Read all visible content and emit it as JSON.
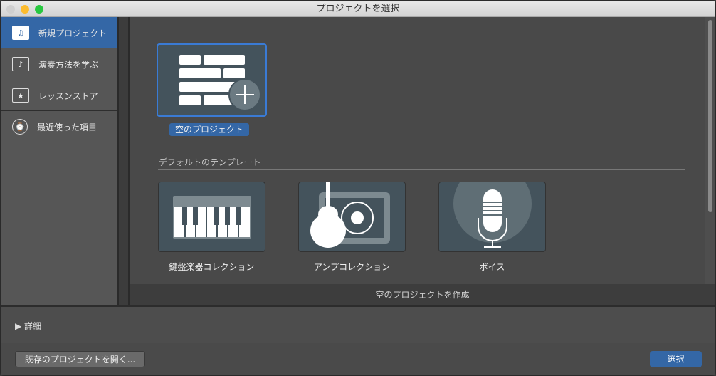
{
  "window": {
    "title": "プロジェクトを選択"
  },
  "sidebar": {
    "items": [
      {
        "label": "新規プロジェクト",
        "icon": "guitar-doc-icon"
      },
      {
        "label": "演奏方法を学ぶ",
        "icon": "note-icon"
      },
      {
        "label": "レッスンストア",
        "icon": "star-icon"
      },
      {
        "label": "最近使った項目",
        "icon": "clock-icon"
      }
    ]
  },
  "main": {
    "empty_project": "空のプロジェクト",
    "section_title": "デフォルトのテンプレート",
    "templates": [
      {
        "label": "鍵盤楽器コレクション"
      },
      {
        "label": "アンプコレクション"
      },
      {
        "label": "ボイス"
      }
    ],
    "status": "空のプロジェクトを作成"
  },
  "details": {
    "label": "▶ 詳細"
  },
  "footer": {
    "open_existing": "既存のプロジェクトを開く...",
    "choose": "選択"
  },
  "colors": {
    "accent": "#3467a6"
  }
}
